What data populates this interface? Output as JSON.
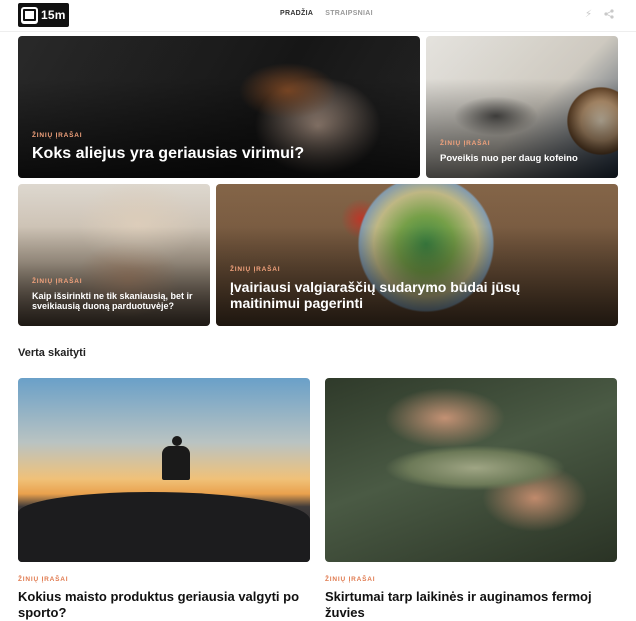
{
  "header": {
    "logo_text": "15m",
    "nav": [
      {
        "label": "PRADŽIA",
        "active": true
      },
      {
        "label": "STRAIPSNIAI",
        "active": false
      }
    ],
    "icons": [
      "lightning-icon",
      "share-icon"
    ]
  },
  "featured": [
    {
      "category": "ŽINIŲ ĮRAŠAI",
      "title": "Koks aliejus yra geriausias virimui?"
    },
    {
      "category": "ŽINIŲ ĮRAŠAI",
      "title": "Poveikis nuo per daug kofeino"
    },
    {
      "category": "ŽINIŲ ĮRAŠAI",
      "title": "Kaip išsirinkti ne tik skaniausią, bet ir sveikiausią duoną parduotuvėje?"
    },
    {
      "category": "ŽINIŲ ĮRAŠAI",
      "title": "Įvairiausi valgiaraščių sudarymo būdai jūsų maitinimui pagerinti"
    }
  ],
  "section": {
    "title": "Verta skaityti"
  },
  "articles": [
    {
      "category": "ŽINIŲ ĮRAŠAI",
      "title": "Kokius maisto produktus geriausia valgyti po sporto?"
    },
    {
      "category": "ŽINIŲ ĮRAŠAI",
      "title": "Skirtumai tarp laikinės ir auginamos fermoj žuvies"
    }
  ],
  "colors": {
    "accent": "#e07a4f",
    "header_bg": "#ffffff",
    "logo_bg": "#111111"
  }
}
